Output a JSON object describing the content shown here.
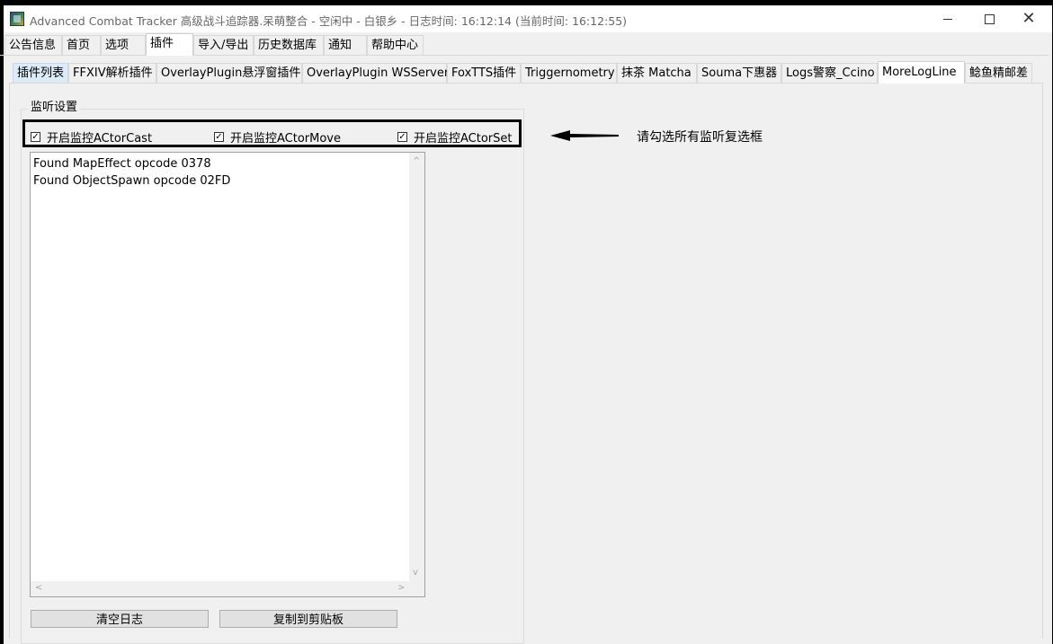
{
  "window": {
    "title": "Advanced Combat Tracker 高级战斗追踪器.呆萌整合 - 空闲中 - 白银乡 - 日志时间: 16:12:14 (当前时间: 16:12:55)",
    "controls": {
      "minimize_icon": "minimize-icon",
      "maximize_icon": "maximize-icon",
      "close_icon": "close-icon",
      "close_glyph": "✕"
    }
  },
  "main_tabs": [
    {
      "label": "公告信息"
    },
    {
      "label": "首页"
    },
    {
      "label": "选项"
    },
    {
      "label": "插件"
    },
    {
      "label": "导入/导出"
    },
    {
      "label": "历史数据库"
    },
    {
      "label": "通知"
    },
    {
      "label": "帮助中心"
    }
  ],
  "main_tabs_active": "插件",
  "plugin_tabs": [
    {
      "label": "插件列表"
    },
    {
      "label": "FFXIV解析插件"
    },
    {
      "label": "OverlayPlugin悬浮窗插件"
    },
    {
      "label": "OverlayPlugin WSServer"
    },
    {
      "label": "FoxTTS插件"
    },
    {
      "label": "Triggernometry"
    },
    {
      "label": "抹茶 Matcha"
    },
    {
      "label": "Souma下惠器"
    },
    {
      "label": "Logs警察_Ccino"
    },
    {
      "label": "MoreLogLine"
    },
    {
      "label": "鲶鱼精邮差"
    }
  ],
  "plugin_tabs_active": "MoreLogLine",
  "listen_settings": {
    "group_title": "监听设置",
    "checkboxes": [
      {
        "label": "开启监控ACtorCast",
        "checked": true
      },
      {
        "label": "开启监控ACtorMove",
        "checked": true
      },
      {
        "label": "开启监控ACtorSet",
        "checked": true
      }
    ],
    "check_glyph": "✓"
  },
  "annotation": {
    "text": "请勾选所有监听复选框",
    "arrow_icon": "left-arrow-icon"
  },
  "log": {
    "lines": [
      "Found MapEffect opcode 0378",
      "Found ObjectSpawn opcode 02FD"
    ],
    "scroll_up": "^",
    "scroll_down": "v",
    "scroll_left": "<",
    "scroll_right": ">"
  },
  "buttons": {
    "clear_log": "清空日志",
    "copy_clipboard": "复制到剪贴板"
  }
}
